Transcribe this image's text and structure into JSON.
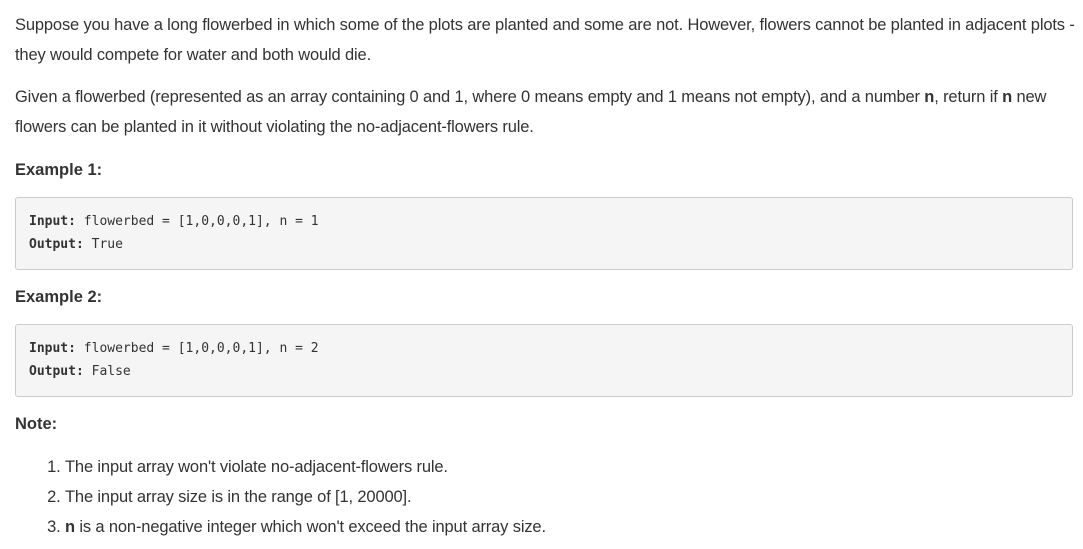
{
  "intro": {
    "p1": "Suppose you have a long flowerbed in which some of the plots are planted and some are not. However, flowers cannot be planted in adjacent plots - they would compete for water and both would die.",
    "p2_a": "Given a flowerbed (represented as an array containing 0 and 1, where 0 means empty and 1 means not empty), and a number ",
    "p2_n1": "n",
    "p2_b": ", return if ",
    "p2_n2": "n",
    "p2_c": " new flowers can be planted in it without violating the no-adjacent-flowers rule."
  },
  "examples": [
    {
      "heading": "Example 1:",
      "input_label": "Input:",
      "input_value": " flowerbed = [1,0,0,0,1], n = 1",
      "output_label": "Output:",
      "output_value": " True"
    },
    {
      "heading": "Example 2:",
      "input_label": "Input:",
      "input_value": " flowerbed = [1,0,0,0,1], n = 2",
      "output_label": "Output:",
      "output_value": " False"
    }
  ],
  "note": {
    "heading": "Note:",
    "items": [
      {
        "text": "The input array won't violate no-adjacent-flowers rule."
      },
      {
        "text": "The input array size is in the range of [1, 20000]."
      },
      {
        "bold": "n",
        "text": " is a non-negative integer which won't exceed the input array size."
      }
    ]
  }
}
